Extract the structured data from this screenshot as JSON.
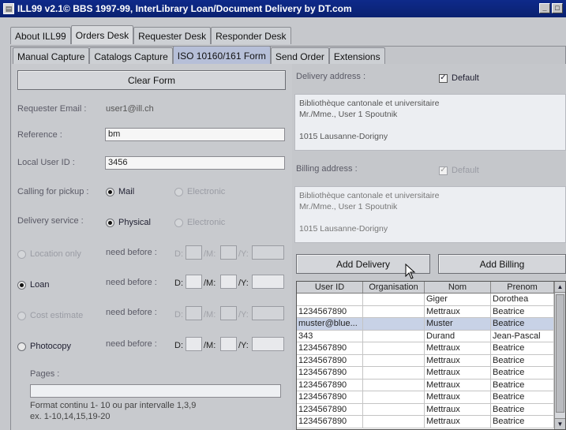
{
  "window": {
    "title": "ILL99 v2.1© BBS 1997-99, InterLibrary Loan/Document Delivery by DT.com",
    "icon": "app-icon",
    "controls": [
      "minimize-icon",
      "maximize-icon"
    ]
  },
  "main_tabs": [
    "About ILL99",
    "Orders Desk",
    "Requester Desk",
    "Responder Desk"
  ],
  "sub_tabs": [
    "Manual Capture",
    "Catalogs Capture",
    "ISO 10160/161 Form",
    "Send Order",
    "Extensions"
  ],
  "form": {
    "clear_button": "Clear Form",
    "requester_email_label": "Requester Email :",
    "requester_email_value": "user1@ill.ch",
    "reference_label": "Reference :",
    "reference_value": "bm",
    "local_user_id_label": "Local User ID :",
    "local_user_id_value": "3456",
    "calling_label": "Calling for pickup :",
    "calling_options": [
      "Mail",
      "Electronic"
    ],
    "delivery_service_label": "Delivery service :",
    "delivery_service_options": [
      "Physical",
      "Electronic"
    ],
    "service_types": [
      "Location only",
      "Loan",
      "Cost estimate",
      "Photocopy"
    ],
    "need_before_label": "need before :",
    "date_labels": [
      "D:",
      "/M:",
      "/Y:"
    ],
    "pages_label": "Pages :",
    "pages_value": "",
    "hint_line1": "Format continu 1- 10 ou par intervalle 1,3,9",
    "hint_line2": "ex. 1-10,14,15,19-20"
  },
  "delivery": {
    "label": "Delivery address :",
    "default_label": "Default",
    "default_checked": true,
    "address": [
      "Bibliothèque cantonale et universitaire",
      "Mr./Mme., User 1 Spoutnik",
      "",
      "1015 Lausanne-Dorigny"
    ]
  },
  "billing": {
    "label": "Billing address :",
    "default_label": "Default",
    "default_checked": true,
    "address": [
      "Bibliothèque cantonale et universitaire",
      "Mr./Mme., User 1 Spoutnik",
      "",
      "1015 Lausanne-Dorigny"
    ]
  },
  "buttons": {
    "add_delivery": "Add Delivery",
    "add_billing": "Add Billing"
  },
  "table": {
    "columns": [
      "User ID",
      "Organisation",
      "Nom",
      "Prenom"
    ],
    "rows": [
      [
        "",
        "",
        "Giger",
        "Dorothea"
      ],
      [
        "1234567890",
        "",
        "Mettraux",
        "Beatrice"
      ],
      [
        "muster@blue...",
        "",
        "Muster",
        "Beatrice"
      ],
      [
        "343",
        "",
        "Durand",
        "Jean-Pascal"
      ],
      [
        "1234567890",
        "",
        "Mettraux",
        "Beatrice"
      ],
      [
        "1234567890",
        "",
        "Mettraux",
        "Beatrice"
      ],
      [
        "1234567890",
        "",
        "Mettraux",
        "Beatrice"
      ],
      [
        "1234567890",
        "",
        "Mettraux",
        "Beatrice"
      ],
      [
        "1234567890",
        "",
        "Mettraux",
        "Beatrice"
      ],
      [
        "1234567890",
        "",
        "Mettraux",
        "Beatrice"
      ],
      [
        "1234567890",
        "",
        "Mettraux",
        "Beatrice"
      ]
    ]
  }
}
